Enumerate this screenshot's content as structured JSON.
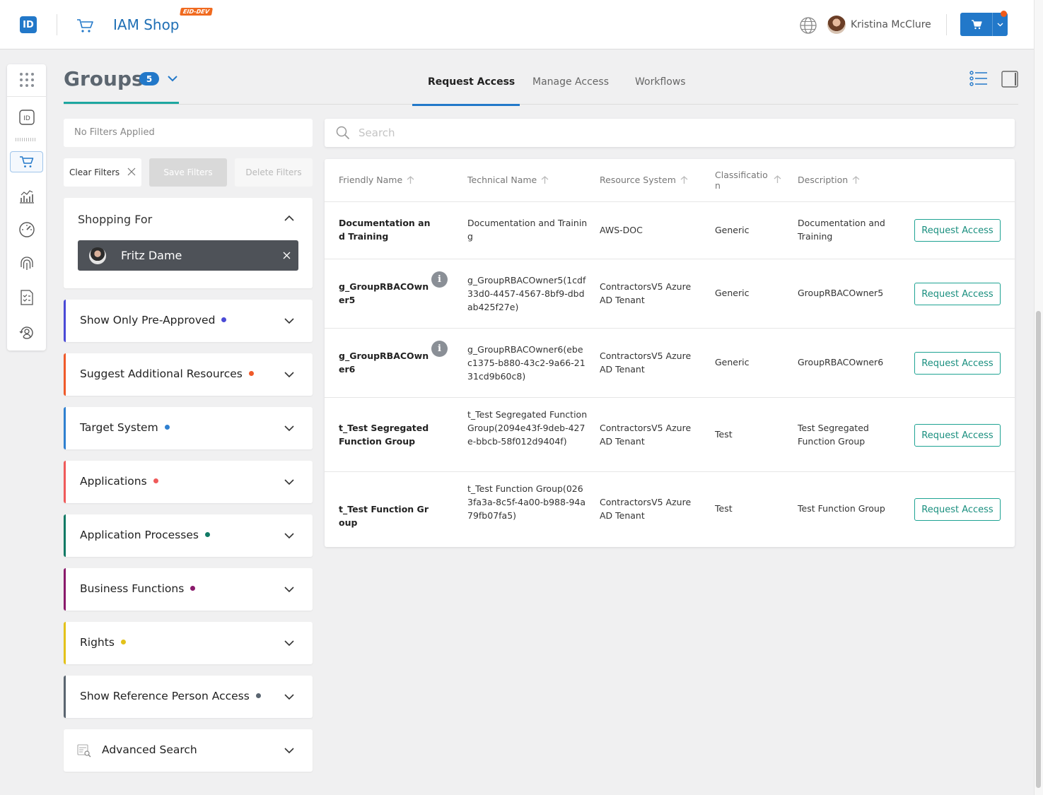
{
  "header": {
    "app_title": "IAM Shop",
    "env_badge": "EID-DEV",
    "username": "Kristina McClure",
    "logo_text": "ID",
    "notification": true
  },
  "page": {
    "title": "Groups",
    "count": "5",
    "tabs": [
      {
        "label": "Request Access",
        "active": true
      },
      {
        "label": "Manage Access",
        "active": false
      },
      {
        "label": "Workflows",
        "active": false
      }
    ]
  },
  "filters": {
    "status": "No Filters Applied",
    "clear_label": "Clear Filters",
    "save_label": "Save Filters",
    "delete_label": "Delete Filters",
    "shopping_for_title": "Shopping For",
    "shopping_for_person": "Fritz Dame",
    "sections": [
      {
        "label": "Show Only Pre-Approved",
        "color": "#4a4ad6"
      },
      {
        "label": "Suggest Additional Resources",
        "color": "#ef5a2a"
      },
      {
        "label": "Target System",
        "color": "#2f80d0"
      },
      {
        "label": "Applications",
        "color": "#ef5a5a"
      },
      {
        "label": "Application Processes",
        "color": "#117a65"
      },
      {
        "label": "Business Functions",
        "color": "#8a1a6b"
      },
      {
        "label": "Rights",
        "color": "#e3c21a"
      },
      {
        "label": "Show Reference Person Access",
        "color": "#5a6570"
      }
    ],
    "advanced_search": "Advanced Search"
  },
  "search": {
    "placeholder": "Search"
  },
  "table": {
    "columns": [
      "Friendly Name",
      "Technical Name",
      "Resource System",
      "Classification",
      "Description"
    ],
    "action_label": "Request Access",
    "rows": [
      {
        "friendly": "Documentation and Training",
        "technical": "Documentation and Training",
        "system": "AWS-DOC",
        "classification": "Generic",
        "description": "Documentation and Training",
        "info": false
      },
      {
        "friendly": "g_GroupRBACOwner5",
        "technical": "g_GroupRBACOwner5(1cdf33d0-4457-4567-8bf9-dbdab425f27e)",
        "system": "ContractorsV5 Azure AD Tenant",
        "classification": "Generic",
        "description": "GroupRBACOwner5",
        "info": true
      },
      {
        "friendly": "g_GroupRBACOwner6",
        "technical": "g_GroupRBACOwner6(ebec1375-b880-43c2-9a66-2131cd9b60c8)",
        "system": "ContractorsV5 Azure AD Tenant",
        "classification": "Generic",
        "description": "GroupRBACOwner6",
        "info": true
      },
      {
        "friendly": "t_Test Segregated Function Group",
        "technical": "t_Test Segregated Function Group(2094e43f-9deb-427e-bbcb-58f012d9404f)",
        "system": "ContractorsV5 Azure AD Tenant",
        "classification": "Test",
        "description": "Test Segregated Function Group",
        "info": false
      },
      {
        "friendly": "t_Test Function Group",
        "technical": "t_Test Function Group(0263fa3a-8c5f-4a00-b988-94a79fb07fa5)",
        "system": "ContractorsV5 Azure AD Tenant",
        "classification": "Test",
        "description": "Test Function Group",
        "info": false
      }
    ]
  }
}
